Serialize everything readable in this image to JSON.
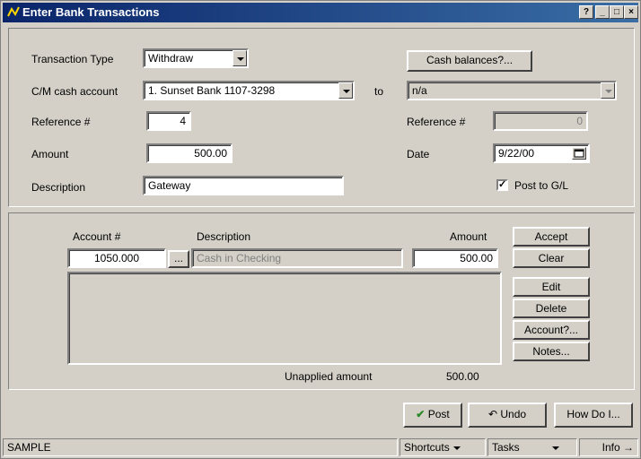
{
  "window": {
    "title": "Enter Bank Transactions"
  },
  "titlebar_buttons": {
    "help": "?",
    "minimize": "_",
    "maximize": "□",
    "close": "×"
  },
  "header": {
    "transaction_type_label": "Transaction Type",
    "transaction_type_value": "Withdraw",
    "cm_account_label": "C/M cash account",
    "cm_account_value": "1. Sunset Bank 1107-3298",
    "to_label": "to",
    "to_account_value": "n/a",
    "cash_balances_button": "Cash balances?...",
    "reference_label": "Reference #",
    "reference_value": "4",
    "reference2_label": "Reference #",
    "reference2_value": "0",
    "amount_label": "Amount",
    "amount_value": "500.00",
    "date_label": "Date",
    "date_value": "9/22/00",
    "description_label": "Description",
    "description_value": "Gateway",
    "post_to_gl_label": "Post to G/L",
    "post_to_gl_checked": "✓"
  },
  "distribution": {
    "account_header": "Account #",
    "description_header": "Description",
    "amount_header": "Amount",
    "account_value": "1050.000",
    "lookup_label": "...",
    "description_value": "Cash in Checking",
    "amount_value": "500.00",
    "unapplied_label": "Unapplied amount",
    "unapplied_value": "500.00"
  },
  "side_buttons": {
    "accept": "Accept",
    "clear": "Clear",
    "edit": "Edit",
    "delete": "Delete",
    "account": "Account?...",
    "notes": "Notes..."
  },
  "footer_buttons": {
    "post": "Post",
    "undo": "Undo",
    "how_do_i": "How Do I..."
  },
  "statusbar": {
    "mode": "SAMPLE",
    "shortcuts": "Shortcuts",
    "tasks": "Tasks",
    "info": "Info"
  },
  "colors": {
    "title_bar": "#0a246a",
    "face": "#d4d0c8",
    "post_check": "#2a8a2a"
  }
}
